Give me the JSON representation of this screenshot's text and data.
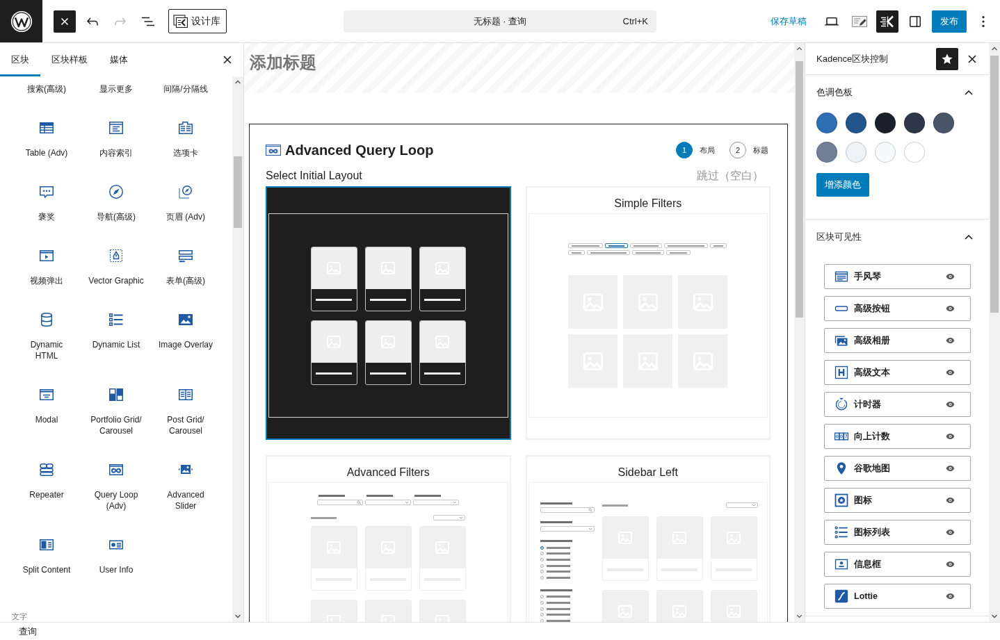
{
  "toolbar": {
    "inserter_open": true,
    "undo_enabled": true,
    "redo_enabled": false,
    "library_button": "设计库",
    "document_bar": {
      "title": "无标题 · 查询",
      "shortcut": "Ctrl+K"
    },
    "save_draft": "保存草稿",
    "kadence_pressed": true,
    "settings_pressed": false,
    "publish": "发布"
  },
  "inserter": {
    "tabs": [
      {
        "label": "区块",
        "selected": true
      },
      {
        "label": "区块样板",
        "selected": false
      },
      {
        "label": "媒体",
        "selected": false
      }
    ],
    "cut_row": [
      "搜索(高级)",
      "显示更多",
      "间隔/分隔线"
    ],
    "blocks": [
      {
        "label": "Table (Adv)"
      },
      {
        "label": "内容索引"
      },
      {
        "label": "选项卡"
      },
      {
        "label": "褒奖"
      },
      {
        "label": "导航(高级)"
      },
      {
        "label": "页眉 (Adv)"
      },
      {
        "label": "视频弹出"
      },
      {
        "label": "Vector Graphic"
      },
      {
        "label": "表单(高级)"
      },
      {
        "label": "Dynamic\nHTML"
      },
      {
        "label": "Dynamic List"
      },
      {
        "label": "Image Overlay"
      },
      {
        "label": "Modal"
      },
      {
        "label": "Portfolio Grid/\nCarousel"
      },
      {
        "label": "Post Grid/\nCarousel"
      },
      {
        "label": "Repeater"
      },
      {
        "label": "Query Loop\n(Adv)"
      },
      {
        "label": "Advanced\nSlider"
      },
      {
        "label": "Split Content"
      },
      {
        "label": "User Info"
      }
    ],
    "next_category": "文字"
  },
  "editor": {
    "title": {
      "placeholder": "添加标题"
    },
    "query_loop": {
      "title": "Advanced Query Loop",
      "steps": [
        {
          "number": "1",
          "label": "布局",
          "selected": true
        },
        {
          "number": "2",
          "label": "标题",
          "selected": false
        }
      ],
      "subtitle": "Select Initial Layout",
      "skip": "跳过（空白）",
      "layouts": [
        {
          "kind": "grid",
          "selected": true
        },
        {
          "kind": "simple-filters",
          "title": "Simple Filters",
          "selected": false
        },
        {
          "kind": "advanced-filters",
          "title": "Advanced Filters",
          "selected": false
        },
        {
          "kind": "sidebar-left",
          "title": "Sidebar Left",
          "selected": false
        }
      ]
    }
  },
  "kadence_panel": {
    "title": "Kadence区块控制",
    "sections": [
      {
        "kind": "palette",
        "title": "色调色板",
        "expanded": true,
        "swatches": [
          {
            "color": "#2f6db5"
          },
          {
            "color": "#22558b"
          },
          {
            "color": "#1a202c"
          },
          {
            "color": "#2d3748"
          },
          {
            "color": "#4a5568"
          },
          {
            "color": "#718096"
          },
          {
            "color": "#edf2f7"
          },
          {
            "color": "#f7fafc"
          },
          {
            "color": "#ffffff"
          }
        ],
        "button": "增添颜色"
      },
      {
        "kind": "visibility",
        "title": "区块可见性",
        "expanded": true,
        "items": [
          {
            "label": "手风琴",
            "visible": true
          },
          {
            "label": "高级按钮",
            "visible": true
          },
          {
            "label": "高级相册",
            "visible": true
          },
          {
            "label": "高级文本",
            "visible": true
          },
          {
            "label": "计时器",
            "visible": true
          },
          {
            "label": "向上计数",
            "visible": true
          },
          {
            "label": "谷歌地图",
            "visible": true
          },
          {
            "label": "图标",
            "visible": true
          },
          {
            "label": "图标列表",
            "visible": true
          },
          {
            "label": "信息框",
            "visible": true
          },
          {
            "label": "Lottie",
            "visible": true
          }
        ]
      }
    ]
  },
  "status_bar": {
    "breadcrumb": "查询"
  }
}
